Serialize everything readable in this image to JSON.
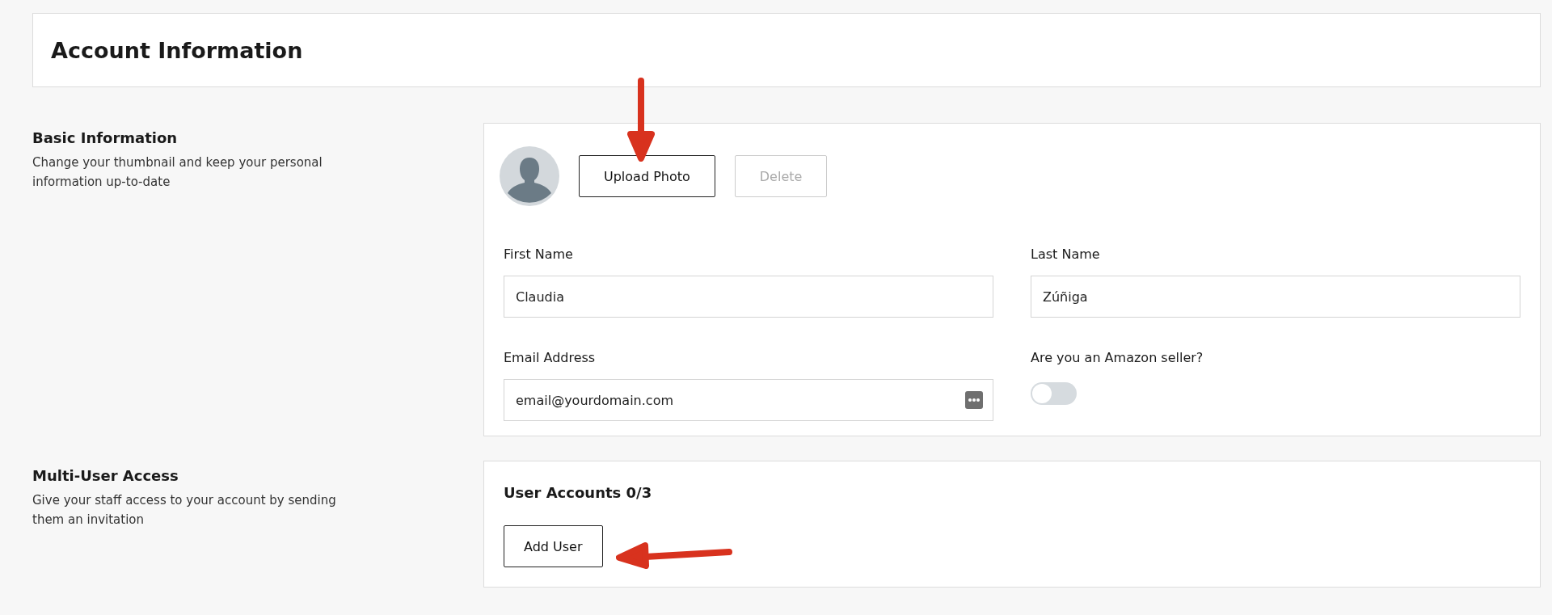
{
  "page": {
    "title": "Account Information"
  },
  "basic_information": {
    "heading": "Basic Information",
    "description": "Change your thumbnail and keep your personal information up-to-date",
    "photo_buttons": [
      {
        "label": "Upload Photo",
        "disabled": false
      },
      {
        "label": "Delete",
        "disabled": true
      }
    ],
    "fields": [
      {
        "label": "First Name",
        "value": "Claudia",
        "kind": "text"
      },
      {
        "label": "Last Name",
        "value": "Zúñiga",
        "kind": "text"
      },
      {
        "label": "Email Address",
        "value": "email@yourdomain.com",
        "kind": "email"
      },
      {
        "label": "Are you an Amazon seller?",
        "on": false,
        "kind": "toggle"
      }
    ]
  },
  "multi_user_access": {
    "heading": "Multi-User Access",
    "description": "Give your staff access to your account by sending them an invitation",
    "accounts_title": "User Accounts 0/3",
    "button": "Add User"
  }
}
